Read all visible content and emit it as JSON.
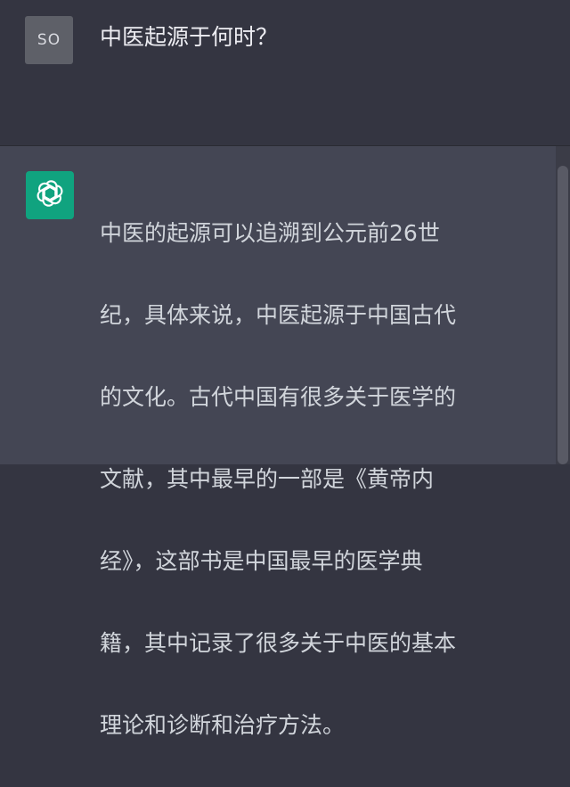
{
  "user_message": {
    "avatar_initials": "SO",
    "text": "中医起源于何时？"
  },
  "assistant_message": {
    "avatar_icon": "openai-logo-icon",
    "lines": [
      "中医的起源可以追溯到公元前26世",
      "纪，具体来说，中医起源于中国古代",
      "的文化。古代中国有很多关于医学的",
      "文献，其中最早的一部是《黄帝内",
      "经》，这部书是中国最早的医学典",
      "籍，其中记录了很多关于中医的基本",
      "理论和诊断和治疗方法。"
    ]
  },
  "colors": {
    "page_background": "#343541",
    "assistant_background": "#444654",
    "user_avatar": "#5e6068",
    "assistant_avatar": "#10a37f",
    "text": "#d1d5db"
  }
}
